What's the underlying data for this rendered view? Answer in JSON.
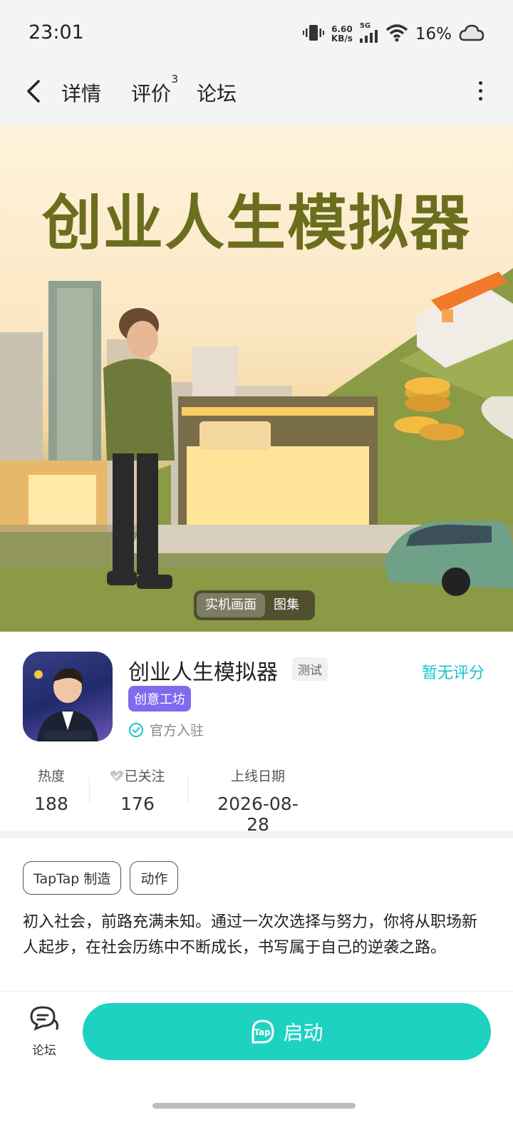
{
  "status_bar": {
    "time": "23:01",
    "net_speed_value": "6.60",
    "net_speed_unit": "KB/s",
    "network_type": "5G",
    "battery": "16%"
  },
  "nav": {
    "tabs": [
      {
        "label": "详情",
        "active": true
      },
      {
        "label": "评价",
        "badge": "3"
      },
      {
        "label": "论坛"
      }
    ]
  },
  "banner": {
    "title": "创业人生模拟器",
    "gallery_tabs": [
      "实机画面",
      "图集"
    ]
  },
  "app": {
    "name": "创业人生模拟器",
    "test_badge": "测试",
    "rating_text": "暂无评分",
    "studio": "创意工坊",
    "official": "官方入驻",
    "stats": [
      {
        "label": "热度",
        "value": "188"
      },
      {
        "label": "已关注",
        "value": "176"
      },
      {
        "label": "上线日期",
        "value": "2026-08-28"
      }
    ]
  },
  "tags": [
    "TapTap 制造",
    "动作"
  ],
  "description": "初入社会，前路充满未知。通过一次次选择与努力，你将从职场新人起步，在社会历练中不断成长，书写属于自己的逆袭之路。",
  "bottom": {
    "forum_label": "论坛",
    "launch_label": "启动",
    "launch_icon_text": "Tap"
  },
  "colors": {
    "accent": "#15c5ce",
    "launch": "#1ed2c1",
    "studio": "#7f6bf0"
  }
}
